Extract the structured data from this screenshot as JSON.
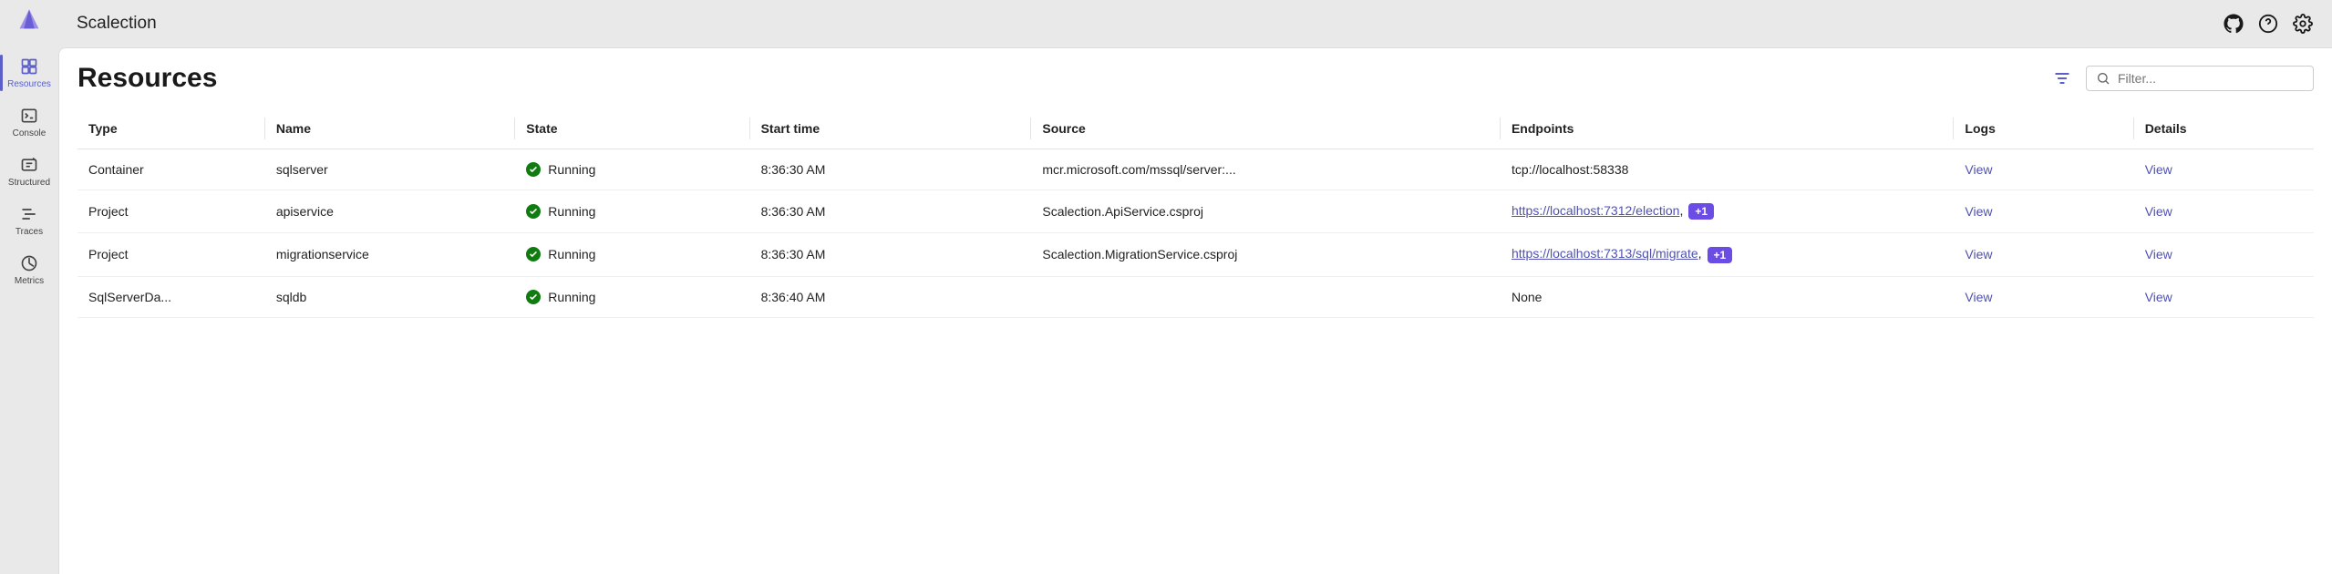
{
  "appTitle": "Scalection",
  "sidebar": {
    "items": [
      {
        "label": "Resources"
      },
      {
        "label": "Console"
      },
      {
        "label": "Structured"
      },
      {
        "label": "Traces"
      },
      {
        "label": "Metrics"
      }
    ]
  },
  "page": {
    "title": "Resources",
    "filterPlaceholder": "Filter..."
  },
  "table": {
    "headers": {
      "type": "Type",
      "name": "Name",
      "state": "State",
      "start": "Start time",
      "source": "Source",
      "endpoints": "Endpoints",
      "logs": "Logs",
      "details": "Details"
    },
    "viewLabel": "View",
    "rows": [
      {
        "type": "Container",
        "name": "sqlserver",
        "state": "Running",
        "start": "8:36:30 AM",
        "source": "mcr.microsoft.com/mssql/server:...",
        "endpointText": "tcp://localhost:58338",
        "endpointLink": false,
        "extra": ""
      },
      {
        "type": "Project",
        "name": "apiservice",
        "state": "Running",
        "start": "8:36:30 AM",
        "source": "Scalection.ApiService.csproj",
        "endpointText": "https://localhost:7312/election",
        "endpointLink": true,
        "extra": "+1"
      },
      {
        "type": "Project",
        "name": "migrationservice",
        "state": "Running",
        "start": "8:36:30 AM",
        "source": "Scalection.MigrationService.csproj",
        "endpointText": "https://localhost:7313/sql/migrate",
        "endpointLink": true,
        "extra": "+1"
      },
      {
        "type": "SqlServerDa...",
        "name": "sqldb",
        "state": "Running",
        "start": "8:36:40 AM",
        "source": "",
        "endpointText": "None",
        "endpointLink": false,
        "extra": ""
      }
    ]
  }
}
